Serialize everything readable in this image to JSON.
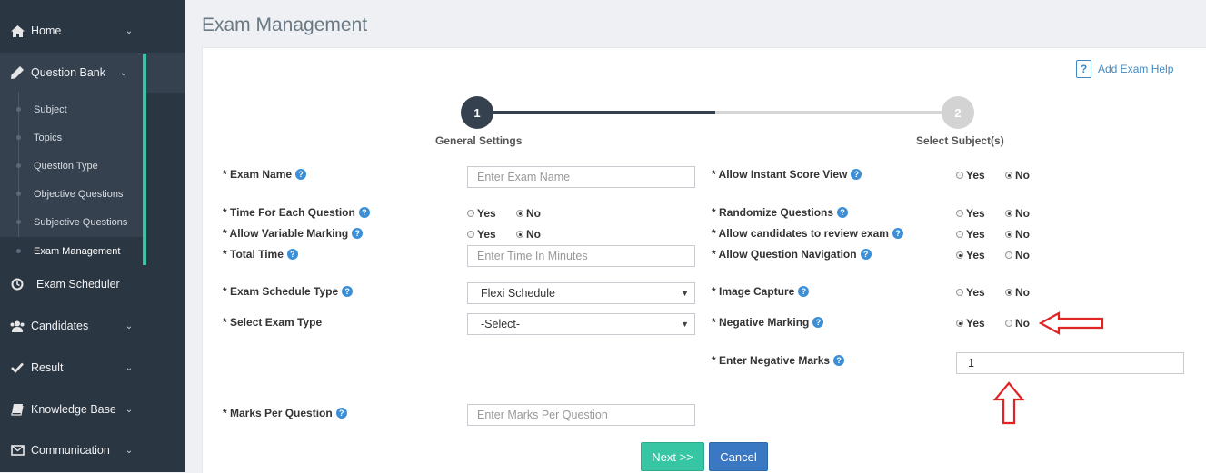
{
  "sidebar": {
    "items": [
      {
        "label": "Home",
        "icon": "home-icon"
      },
      {
        "label": "Question Bank",
        "icon": "pencil-icon"
      },
      {
        "label": "Exam Scheduler",
        "icon": "clock-icon"
      },
      {
        "label": "Candidates",
        "icon": "users-icon"
      },
      {
        "label": "Result",
        "icon": "check-icon"
      },
      {
        "label": "Knowledge Base",
        "icon": "book-icon"
      },
      {
        "label": "Communication",
        "icon": "envelope-icon"
      }
    ],
    "submenu": [
      "Subject",
      "Topics",
      "Question Type",
      "Objective Questions",
      "Subjective Questions",
      "Exam Management"
    ],
    "active_accent": "#36c6a3"
  },
  "page": {
    "title": "Exam Management",
    "help_label": "Add Exam Help"
  },
  "wizard": {
    "steps": [
      {
        "number": "1",
        "label": "General Settings"
      },
      {
        "number": "2",
        "label": "Select Subject(s)"
      }
    ]
  },
  "form": {
    "left": {
      "exam_name_label": "* Exam Name",
      "exam_name_placeholder": "Enter Exam Name",
      "time_each_label": "* Time For Each Question",
      "variable_marking_label": "* Allow Variable Marking",
      "total_time_label": "* Total Time",
      "total_time_placeholder": "Enter Time In Minutes",
      "schedule_type_label": "* Exam Schedule Type",
      "schedule_type_value": "Flexi Schedule",
      "exam_type_label": "* Select Exam Type",
      "exam_type_value": "-Select-",
      "marks_per_q_label": "* Marks Per Question",
      "marks_per_q_placeholder": "Enter Marks Per Question"
    },
    "right": {
      "instant_score_label": "* Allow Instant Score View",
      "randomize_label": "* Randomize Questions",
      "review_label": "* Allow candidates to review exam",
      "navigation_label": "* Allow Question Navigation",
      "image_capture_label": "* Image Capture",
      "negative_marking_label": "* Negative Marking",
      "negative_marks_label": "* Enter Negative Marks",
      "negative_marks_value": "1"
    },
    "yes": "Yes",
    "no": "No",
    "selected": {
      "time_each": "No",
      "variable_marking": "No",
      "instant_score": "No",
      "randomize": "No",
      "review": "No",
      "navigation": "Yes",
      "image_capture": "No",
      "negative_marking": "Yes"
    }
  },
  "buttons": {
    "next": "Next >>",
    "cancel": "Cancel"
  },
  "colors": {
    "sidebar_bg": "#2b3643",
    "next_button": "#36c6a3",
    "cancel_button": "#3b78c4",
    "annotation_arrow": "#e02424"
  }
}
